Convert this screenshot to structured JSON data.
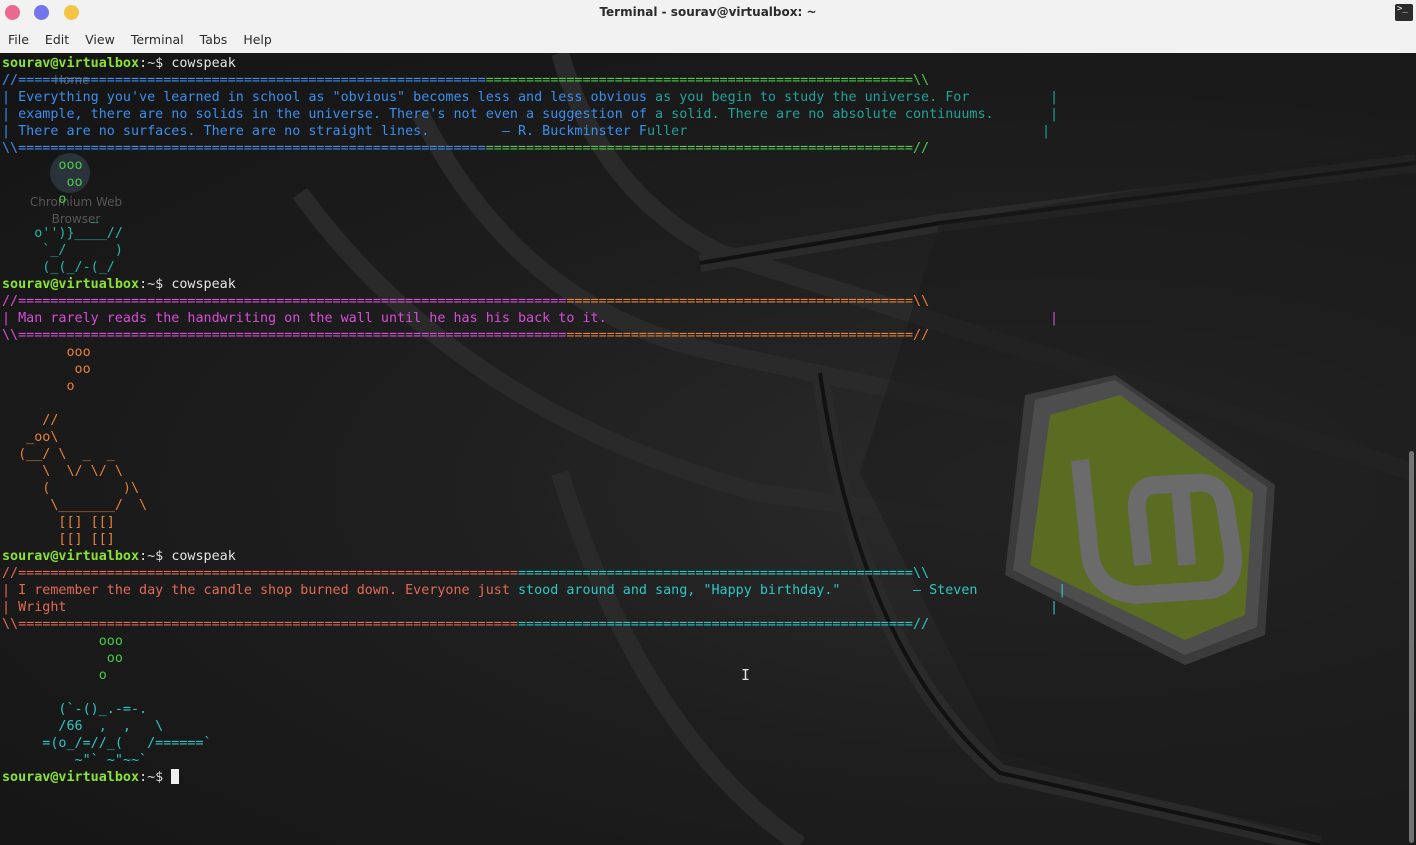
{
  "window": {
    "title": "Terminal - sourav@virtualbox: ~",
    "terminal_icon": ">_"
  },
  "menu": [
    "File",
    "Edit",
    "View",
    "Terminal",
    "Tabs",
    "Help"
  ],
  "desktop_ghost": {
    "home": "Home",
    "chromium_label_1": "Chromium Web",
    "chromium_label_2": "Browser"
  },
  "prompt": {
    "user_host": "sourav@virtualbox",
    "path_symbol": ":~$ ",
    "command": "cowspeak"
  },
  "blocks": [
    {
      "top_border": "//===============================================================================================================\\\\",
      "lines": [
        "| Everything you've learned in school as \"obvious\" becomes less and less obvious as you begin to study the universe. For          |",
        "| example, there are no solids in the universe. There's not even a suggestion of a solid. There are no absolute continuums.       |",
        "| There are no surfaces. There are no straight lines.         — R. Buckminster Fuller                                            |"
      ],
      "bottom_border": "\\\\===============================================================================================================//",
      "art": [
        "       ooo",
        "        oo",
        "       o",
        "           _",
        "    o'')}____//",
        "     `_/      )",
        "     (_(_/-(_/"
      ]
    },
    {
      "top_border": "//===============================================================================================================\\\\",
      "lines": [
        "| Man rarely reads the handwriting on the wall until he has his back to it.                                                       |"
      ],
      "bottom_border": "\\\\===============================================================================================================//",
      "art": [
        "        ooo",
        "         oo",
        "        o",
        "",
        "     //",
        "   _oo\\",
        "  (__/ \\  _  _",
        "     \\  \\/ \\/ \\",
        "     (         )\\",
        "      \\_______/  \\",
        "       [[] [[]",
        "       [[] [[]"
      ]
    },
    {
      "top_border": "//===============================================================================================================\\\\",
      "lines": [
        "| I remember the day the candle shop burned down. Everyone just stood around and sang, \"Happy birthday.\"         — Steven          |",
        "| Wright                                                                                                                          |"
      ],
      "bottom_border": "\\\\===============================================================================================================//",
      "art": [
        "            ooo",
        "             oo",
        "            o",
        "",
        "       (`-()_.-=-.",
        "       /66  ,  ,   \\",
        "     =(o_/=//_(   /======`",
        "         ~\"` ~\"~~`"
      ]
    }
  ],
  "colors": {
    "prompt_green": "#8ae234",
    "block1": "#3a8ff0",
    "block1_border": "#4ec94e",
    "block2": "#d84ed8",
    "block2_art": "#e8803a",
    "block3": "#e26a55",
    "block3_alt": "#2bc7c7",
    "block3_art": "#44cc44"
  }
}
